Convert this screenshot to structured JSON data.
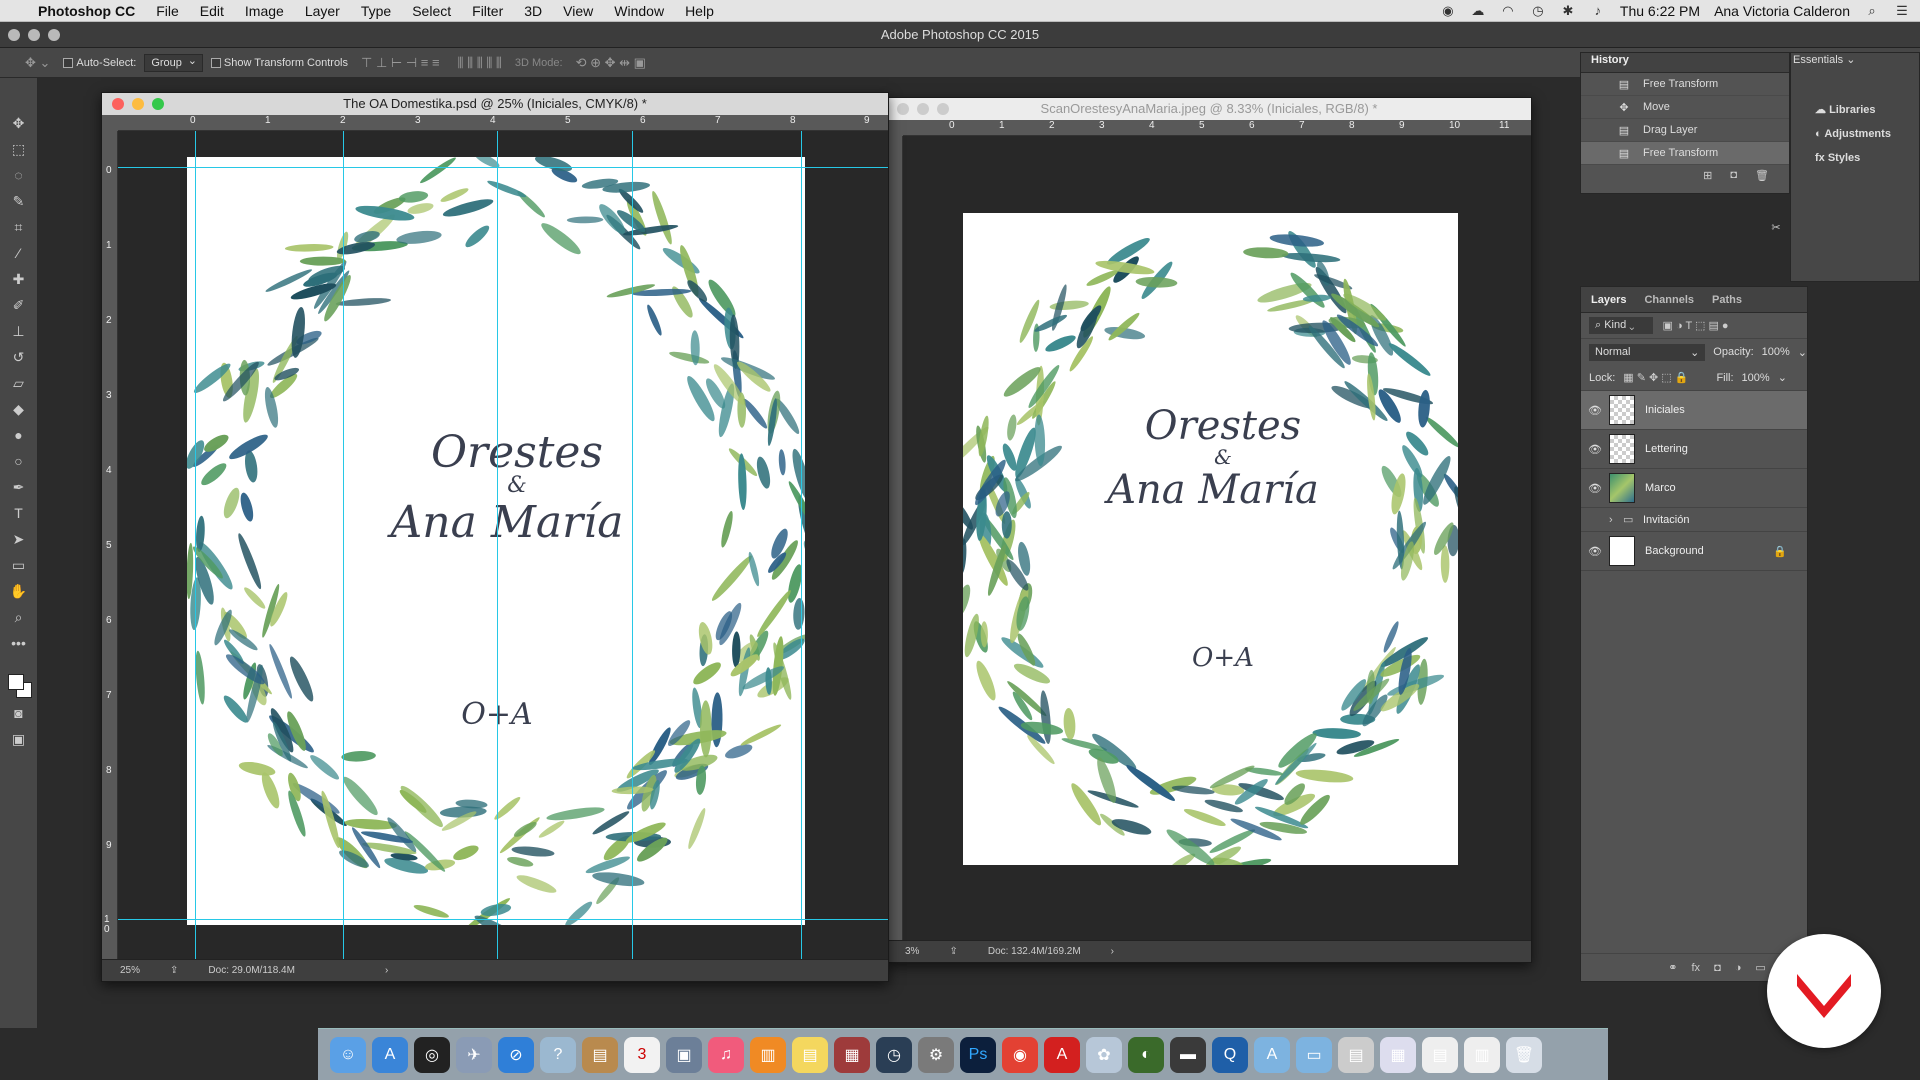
{
  "menubar": {
    "app_name": "Photoshop CC",
    "items": [
      "File",
      "Edit",
      "Image",
      "Layer",
      "Type",
      "Select",
      "Filter",
      "3D",
      "View",
      "Window",
      "Help"
    ],
    "clock": "Thu 6:22 PM",
    "user": "Ana Victoria Calderon"
  },
  "app": {
    "title": "Adobe Photoshop CC 2015"
  },
  "options": {
    "auto_select_label": "Auto-Select:",
    "auto_select_value": "Group",
    "transform_label": "Show Transform Controls",
    "mode_3d_label": "3D Mode:"
  },
  "doc1": {
    "title": "The OA Domestika.psd @ 25% (Iniciales, CMYK/8) *",
    "zoom": "25%",
    "doc_size": "Doc: 29.0M/118.4M",
    "ruler_h": [
      "0",
      "1",
      "2",
      "3",
      "4",
      "5",
      "6",
      "7",
      "8",
      "9"
    ],
    "ruler_v": [
      "0",
      "1",
      "2",
      "3",
      "4",
      "5",
      "6",
      "7",
      "8",
      "9",
      "1 0"
    ]
  },
  "doc2": {
    "title": "ScanOrestesyAnaMaria.jpeg @ 8.33% (Iniciales, RGB/8) *",
    "zoom": "3%",
    "doc_size": "Doc: 132.4M/169.2M",
    "ruler_h": [
      "0",
      "1",
      "2",
      "3",
      "4",
      "5",
      "6",
      "7",
      "8",
      "9",
      "10",
      "11"
    ]
  },
  "lettering": {
    "name1": "Orestes",
    "amp": "&",
    "name2": "Ana María",
    "initials": "O+A"
  },
  "history": {
    "tab": "History",
    "items": [
      "Free Transform",
      "Move",
      "Drag Layer",
      "Free Transform"
    ]
  },
  "side_panel": {
    "essentials": "Essentials",
    "libraries": "Libraries",
    "adjustments": "Adjustments",
    "styles": "Styles"
  },
  "layers": {
    "tabs": [
      "Layers",
      "Channels",
      "Paths"
    ],
    "kind_label": "Kind",
    "blend_mode": "Normal",
    "opacity_label": "Opacity:",
    "opacity": "100%",
    "lock_label": "Lock:",
    "fill_label": "Fill:",
    "fill": "100%",
    "items": [
      "Iniciales",
      "Lettering",
      "Marco",
      "Invitación",
      "Background"
    ]
  },
  "colors": {
    "guide": "#27c8e6",
    "leaf_dark": "#2e6f7a",
    "leaf_light": "#8fb75a",
    "brand_red": "#e31b23"
  }
}
